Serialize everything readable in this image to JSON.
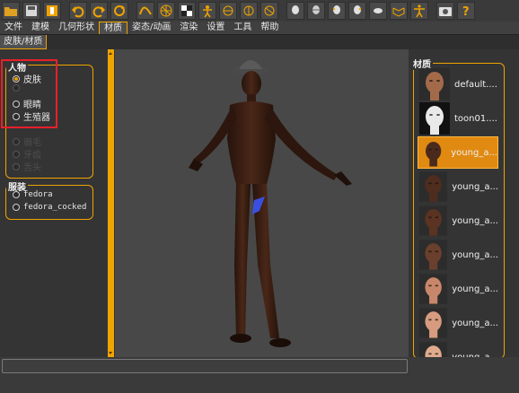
{
  "toolbar": {
    "icons": [
      "undo-icon",
      "redo-icon",
      "reset-icon",
      "smooth-icon",
      "wireframe-icon",
      "background-icon",
      "pose-icon",
      "front-view-icon",
      "back-view-icon",
      "left-view-icon",
      "right-view-icon",
      "top-view-icon",
      "bottom-view-icon",
      "reset-camera-icon",
      "screenshot-icon",
      "help-icon"
    ]
  },
  "menu": {
    "tabs": [
      "文件",
      "建模",
      "几何形状",
      "材质",
      "姿态/动画",
      "渲染",
      "设置",
      "工具",
      "帮助"
    ],
    "active_index": 3
  },
  "subtab": {
    "label": "皮肤/材质"
  },
  "left_panel": {
    "human_group": {
      "title": "人物",
      "options": [
        {
          "label": "皮肤",
          "checked": true
        },
        {
          "label": "眼睛",
          "checked": false
        },
        {
          "label": "生殖器",
          "checked": false
        }
      ],
      "dimmed_options": [
        "眉毛",
        "牙齿",
        "舌头"
      ]
    },
    "clothes_group": {
      "title": "服装",
      "options": [
        "fedora",
        "fedora_cocked"
      ]
    }
  },
  "right_panel": {
    "title": "材质",
    "materials": [
      {
        "label": "default....",
        "skin": "#a36a4a",
        "selected": false
      },
      {
        "label": "toon01....",
        "skin": "#e9e9e9",
        "selected": false
      },
      {
        "label": "young_a...",
        "skin": "#4a2a1c",
        "selected": true
      },
      {
        "label": "young_a...",
        "skin": "#4e2c1e",
        "selected": false
      },
      {
        "label": "young_a...",
        "skin": "#5b3322",
        "selected": false
      },
      {
        "label": "young_a...",
        "skin": "#6a3f2c",
        "selected": false
      },
      {
        "label": "young_a...",
        "skin": "#c8876a",
        "selected": false
      },
      {
        "label": "young_a...",
        "skin": "#d79b7f",
        "selected": false
      },
      {
        "label": "young_a...",
        "skin": "#e0aa8e",
        "selected": false
      }
    ]
  },
  "colors": {
    "accent": "#f0a400",
    "highlight_box": "#e8202a",
    "model_skin": "#3a1f14",
    "genital_proxy": "#3a4fe0"
  }
}
